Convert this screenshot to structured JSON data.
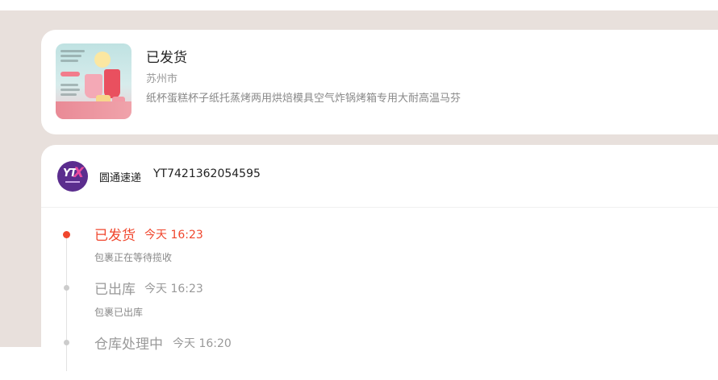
{
  "colors": {
    "page_background": "#e8e0dc",
    "card_background": "#ffffff",
    "accent_active": "#f0462d",
    "muted_text": "#999999",
    "courier_brand": "#5b2d8e"
  },
  "order": {
    "status": "已发货",
    "city": "苏州市",
    "product_name": "纸杯蛋糕杯子纸托蒸烤两用烘焙模具空气炸锅烤箱专用大耐高温马芬",
    "thumbnail_icon": "product-thumbnail-image"
  },
  "courier": {
    "name": "圆通速递",
    "tracking_number": "YT7421362054595",
    "logo_icon": "yto-logo-icon"
  },
  "timeline": [
    {
      "status": "已发货",
      "time": "今天 16:23",
      "desc": "包裹正在等待揽收",
      "active": true
    },
    {
      "status": "已出库",
      "time": "今天 16:23",
      "desc": "包裹已出库",
      "active": false
    },
    {
      "status": "仓库处理中",
      "time": "今天 16:20",
      "desc": "",
      "active": false
    }
  ]
}
